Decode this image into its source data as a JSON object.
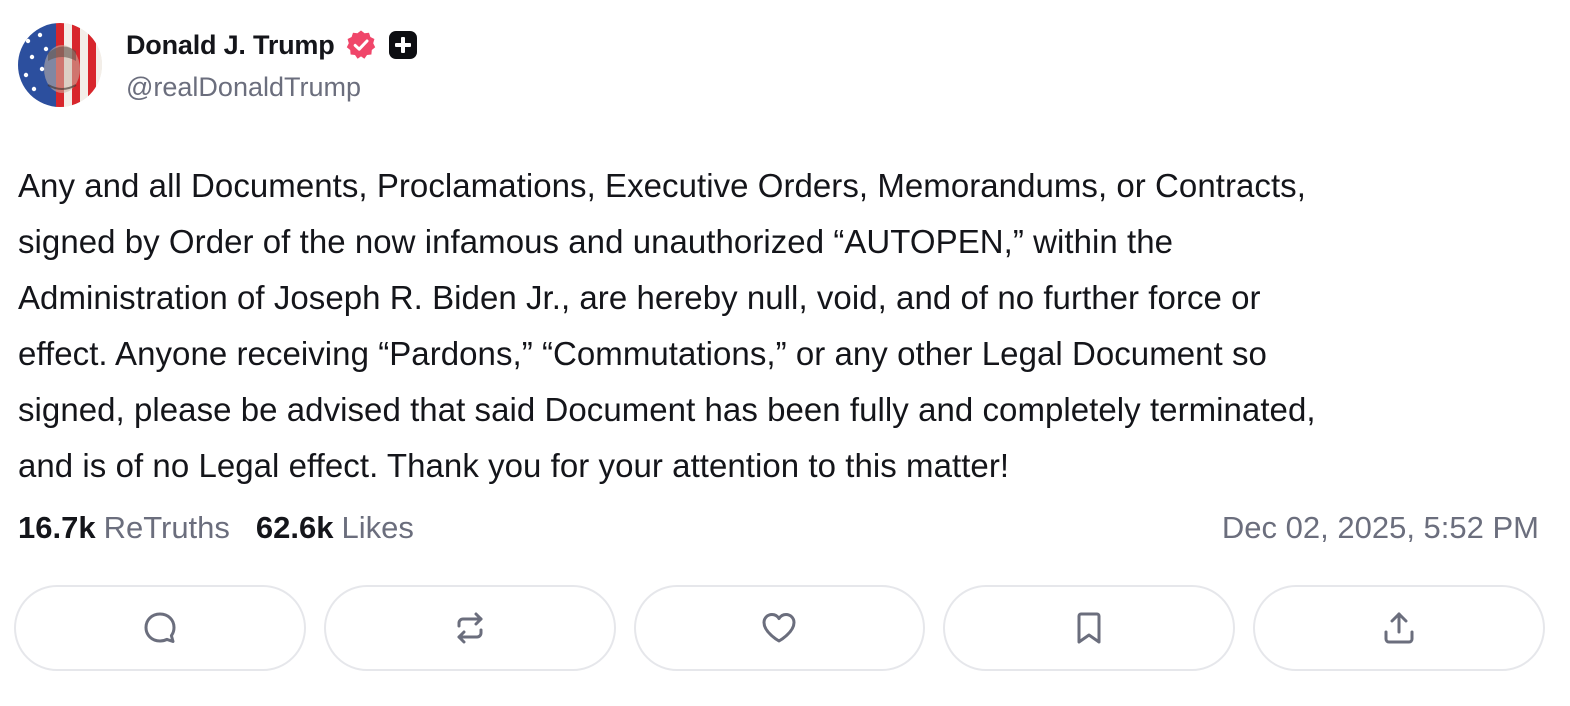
{
  "author": {
    "display_name": "Donald J. Trump",
    "handle": "@realDonaldTrump",
    "verified_badge": "verified-check-badge",
    "plus_badge": "plus-badge",
    "avatar": "avatar-flag-portrait"
  },
  "post": {
    "text": "Any and all Documents, Proclamations, Executive Orders, Memorandums, or Contracts,\nsigned by Order of the now infamous and unauthorized “AUTOPEN,” within the\nAdministration of Joseph R. Biden Jr., are hereby null, void, and of no further force or\neffect. Anyone receiving “Pardons,” “Commutations,” or any other Legal Document so\nsigned, please be advised that said Document has been fully and completely terminated,\nand is of no Legal effect. Thank you for your attention to this matter!",
    "retruths_count": "16.7k",
    "retruths_label": "ReTruths",
    "likes_count": "62.6k",
    "likes_label": "Likes",
    "timestamp": "Dec 02, 2025, 5:52 PM"
  },
  "actions": [
    {
      "name": "reply",
      "icon": "comment-icon"
    },
    {
      "name": "retruth",
      "icon": "repost-icon"
    },
    {
      "name": "like",
      "icon": "heart-icon"
    },
    {
      "name": "bookmark",
      "icon": "bookmark-icon"
    },
    {
      "name": "share",
      "icon": "share-icon"
    }
  ],
  "colors": {
    "text": "#14151a",
    "muted": "#6b6e7d",
    "verified": "#f0466a",
    "button_border": "#e6e7eb"
  }
}
